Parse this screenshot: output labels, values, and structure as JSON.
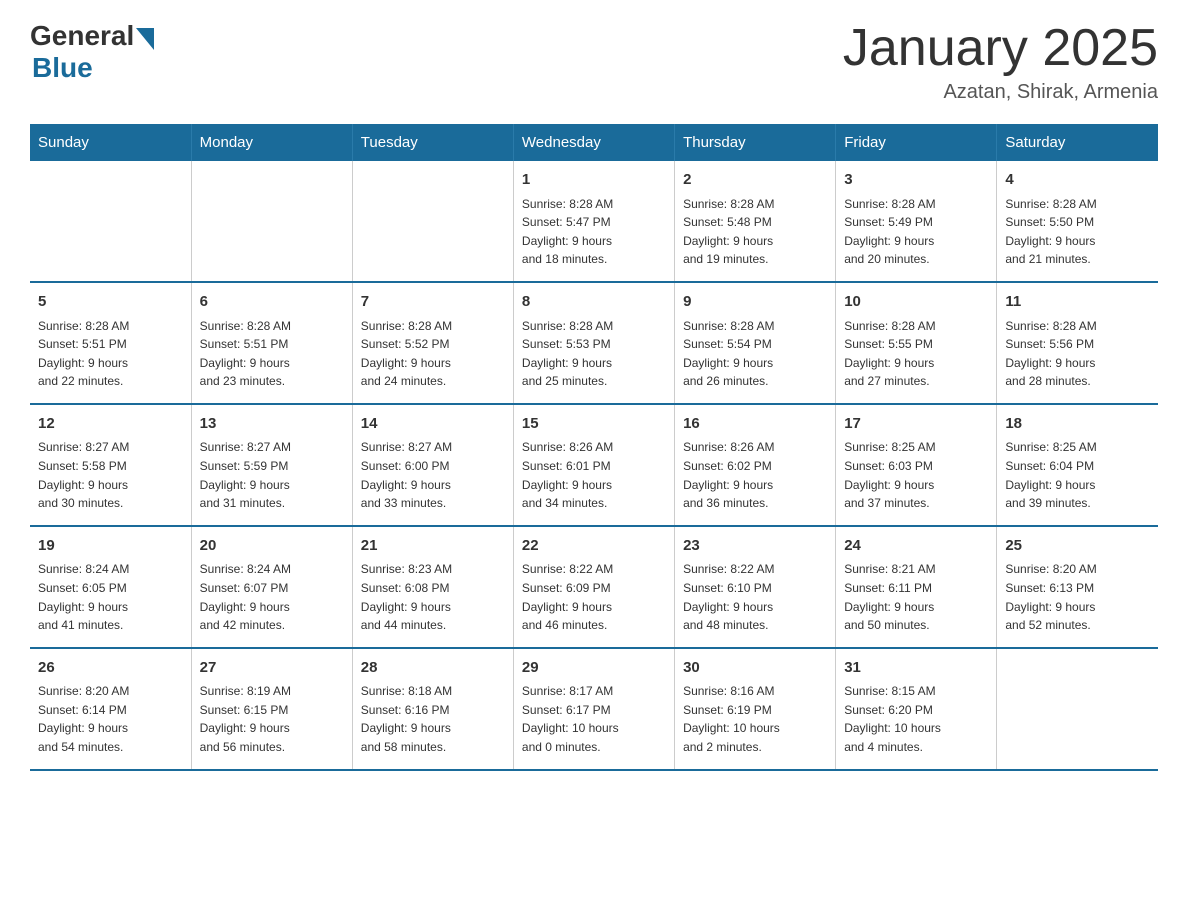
{
  "logo": {
    "general": "General",
    "blue": "Blue"
  },
  "title": "January 2025",
  "location": "Azatan, Shirak, Armenia",
  "days_of_week": [
    "Sunday",
    "Monday",
    "Tuesday",
    "Wednesday",
    "Thursday",
    "Friday",
    "Saturday"
  ],
  "weeks": [
    [
      {
        "day": "",
        "info": ""
      },
      {
        "day": "",
        "info": ""
      },
      {
        "day": "",
        "info": ""
      },
      {
        "day": "1",
        "info": "Sunrise: 8:28 AM\nSunset: 5:47 PM\nDaylight: 9 hours\nand 18 minutes."
      },
      {
        "day": "2",
        "info": "Sunrise: 8:28 AM\nSunset: 5:48 PM\nDaylight: 9 hours\nand 19 minutes."
      },
      {
        "day": "3",
        "info": "Sunrise: 8:28 AM\nSunset: 5:49 PM\nDaylight: 9 hours\nand 20 minutes."
      },
      {
        "day": "4",
        "info": "Sunrise: 8:28 AM\nSunset: 5:50 PM\nDaylight: 9 hours\nand 21 minutes."
      }
    ],
    [
      {
        "day": "5",
        "info": "Sunrise: 8:28 AM\nSunset: 5:51 PM\nDaylight: 9 hours\nand 22 minutes."
      },
      {
        "day": "6",
        "info": "Sunrise: 8:28 AM\nSunset: 5:51 PM\nDaylight: 9 hours\nand 23 minutes."
      },
      {
        "day": "7",
        "info": "Sunrise: 8:28 AM\nSunset: 5:52 PM\nDaylight: 9 hours\nand 24 minutes."
      },
      {
        "day": "8",
        "info": "Sunrise: 8:28 AM\nSunset: 5:53 PM\nDaylight: 9 hours\nand 25 minutes."
      },
      {
        "day": "9",
        "info": "Sunrise: 8:28 AM\nSunset: 5:54 PM\nDaylight: 9 hours\nand 26 minutes."
      },
      {
        "day": "10",
        "info": "Sunrise: 8:28 AM\nSunset: 5:55 PM\nDaylight: 9 hours\nand 27 minutes."
      },
      {
        "day": "11",
        "info": "Sunrise: 8:28 AM\nSunset: 5:56 PM\nDaylight: 9 hours\nand 28 minutes."
      }
    ],
    [
      {
        "day": "12",
        "info": "Sunrise: 8:27 AM\nSunset: 5:58 PM\nDaylight: 9 hours\nand 30 minutes."
      },
      {
        "day": "13",
        "info": "Sunrise: 8:27 AM\nSunset: 5:59 PM\nDaylight: 9 hours\nand 31 minutes."
      },
      {
        "day": "14",
        "info": "Sunrise: 8:27 AM\nSunset: 6:00 PM\nDaylight: 9 hours\nand 33 minutes."
      },
      {
        "day": "15",
        "info": "Sunrise: 8:26 AM\nSunset: 6:01 PM\nDaylight: 9 hours\nand 34 minutes."
      },
      {
        "day": "16",
        "info": "Sunrise: 8:26 AM\nSunset: 6:02 PM\nDaylight: 9 hours\nand 36 minutes."
      },
      {
        "day": "17",
        "info": "Sunrise: 8:25 AM\nSunset: 6:03 PM\nDaylight: 9 hours\nand 37 minutes."
      },
      {
        "day": "18",
        "info": "Sunrise: 8:25 AM\nSunset: 6:04 PM\nDaylight: 9 hours\nand 39 minutes."
      }
    ],
    [
      {
        "day": "19",
        "info": "Sunrise: 8:24 AM\nSunset: 6:05 PM\nDaylight: 9 hours\nand 41 minutes."
      },
      {
        "day": "20",
        "info": "Sunrise: 8:24 AM\nSunset: 6:07 PM\nDaylight: 9 hours\nand 42 minutes."
      },
      {
        "day": "21",
        "info": "Sunrise: 8:23 AM\nSunset: 6:08 PM\nDaylight: 9 hours\nand 44 minutes."
      },
      {
        "day": "22",
        "info": "Sunrise: 8:22 AM\nSunset: 6:09 PM\nDaylight: 9 hours\nand 46 minutes."
      },
      {
        "day": "23",
        "info": "Sunrise: 8:22 AM\nSunset: 6:10 PM\nDaylight: 9 hours\nand 48 minutes."
      },
      {
        "day": "24",
        "info": "Sunrise: 8:21 AM\nSunset: 6:11 PM\nDaylight: 9 hours\nand 50 minutes."
      },
      {
        "day": "25",
        "info": "Sunrise: 8:20 AM\nSunset: 6:13 PM\nDaylight: 9 hours\nand 52 minutes."
      }
    ],
    [
      {
        "day": "26",
        "info": "Sunrise: 8:20 AM\nSunset: 6:14 PM\nDaylight: 9 hours\nand 54 minutes."
      },
      {
        "day": "27",
        "info": "Sunrise: 8:19 AM\nSunset: 6:15 PM\nDaylight: 9 hours\nand 56 minutes."
      },
      {
        "day": "28",
        "info": "Sunrise: 8:18 AM\nSunset: 6:16 PM\nDaylight: 9 hours\nand 58 minutes."
      },
      {
        "day": "29",
        "info": "Sunrise: 8:17 AM\nSunset: 6:17 PM\nDaylight: 10 hours\nand 0 minutes."
      },
      {
        "day": "30",
        "info": "Sunrise: 8:16 AM\nSunset: 6:19 PM\nDaylight: 10 hours\nand 2 minutes."
      },
      {
        "day": "31",
        "info": "Sunrise: 8:15 AM\nSunset: 6:20 PM\nDaylight: 10 hours\nand 4 minutes."
      },
      {
        "day": "",
        "info": ""
      }
    ]
  ]
}
